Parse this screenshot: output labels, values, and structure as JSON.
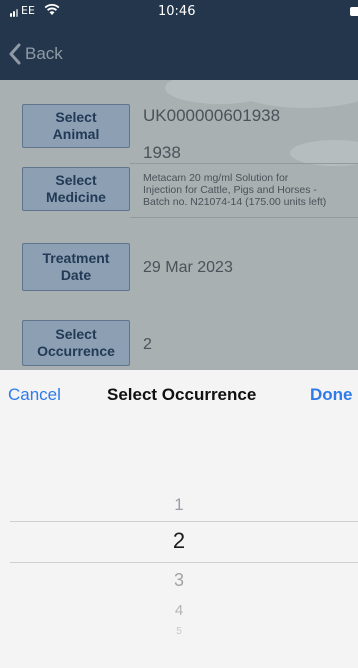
{
  "status_bar": {
    "carrier": "EE",
    "time": "10:46"
  },
  "nav": {
    "back_label": "Back"
  },
  "form": {
    "animal": {
      "button_label_1": "Select",
      "button_label_2": "Animal",
      "value_1": "UK000000601938",
      "value_2": "1938"
    },
    "medicine": {
      "button_label_1": "Select",
      "button_label_2": "Medicine",
      "value_line_1": "Metacam 20 mg/ml Solution for",
      "value_line_2": "Injection for Cattle, Pigs and Horses -",
      "value_line_3": "Batch no. N21074-14 (175.00 units left)"
    },
    "treatment_date": {
      "button_label_1": "Treatment",
      "button_label_2": "Date",
      "value": "29 Mar 2023"
    },
    "occurrence": {
      "button_label_1": "Select",
      "button_label_2": "Occurrence",
      "value": "2"
    }
  },
  "picker_toolbar": {
    "cancel_label": "Cancel",
    "title": "Select Occurrence",
    "done_label": "Done"
  },
  "picker": {
    "options": [
      "1",
      "2",
      "3",
      "4",
      "5"
    ],
    "selected": "2"
  },
  "colors": {
    "header": "#24364b",
    "accent": "#2f7bea",
    "field_button": "#8c9fb3"
  }
}
